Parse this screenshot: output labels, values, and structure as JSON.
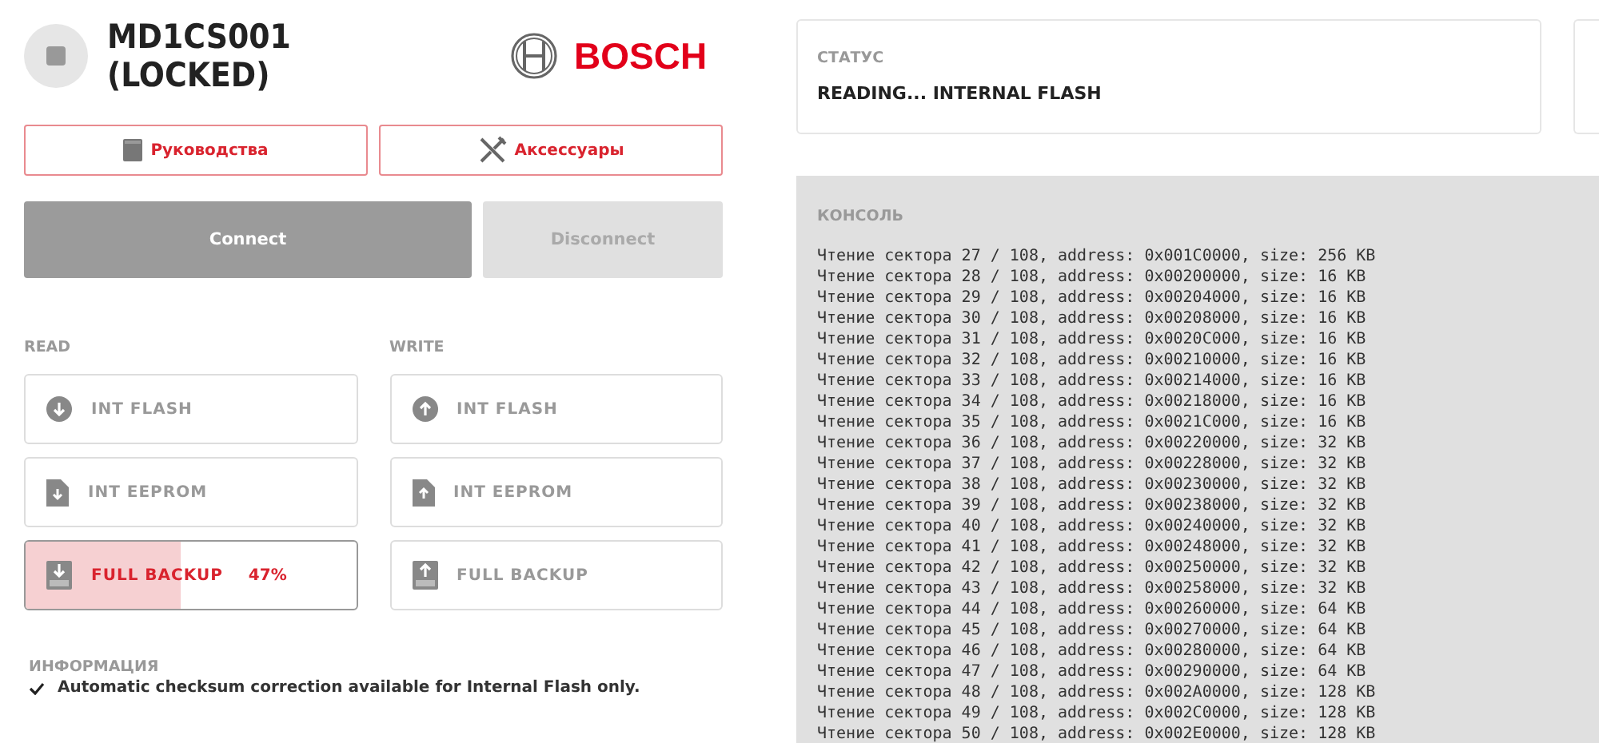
{
  "header": {
    "title": "MD1CS001 (LOCKED)",
    "brand": "BOSCH"
  },
  "links": [
    {
      "label": "Руководства",
      "kind": "book"
    },
    {
      "label": "Аксессуары",
      "kind": "tools"
    }
  ],
  "connection": [
    {
      "label": "Connect",
      "disabled": false
    },
    {
      "label": "Disconnect",
      "disabled": true
    }
  ],
  "read": {
    "title": "READ",
    "items": [
      {
        "label": "INT FLASH",
        "kind": "flash",
        "active": false
      },
      {
        "label": "INT EEPROM",
        "kind": "eeprom",
        "active": false
      },
      {
        "label": "FULL BACKUP",
        "kind": "backup",
        "active": true,
        "level": 0.47,
        "reading": "47%"
      }
    ]
  },
  "write": {
    "title": "WRITE",
    "items": [
      {
        "label": "INT FLASH",
        "kind": "flash",
        "active": false
      },
      {
        "label": "INT EEPROM",
        "kind": "eeprom",
        "active": false
      },
      {
        "label": "FULL BACKUP",
        "kind": "backup",
        "active": false
      }
    ]
  },
  "info": {
    "title": "ИНФОРМАЦИЯ",
    "items": [
      "Automatic checksum correction available for Internal Flash only."
    ]
  },
  "status": {
    "title": "СТАТУС",
    "value": "READING... INTERNAL FLASH"
  },
  "console": {
    "title": "КОНСОЛЬ",
    "lines": [
      "Чтение сектора 27 / 108, address: 0x001C0000, size: 256 KB",
      "Чтение сектора 28 / 108, address: 0x00200000, size: 16 KB",
      "Чтение сектора 29 / 108, address: 0x00204000, size: 16 KB",
      "Чтение сектора 30 / 108, address: 0x00208000, size: 16 KB",
      "Чтение сектора 31 / 108, address: 0x0020C000, size: 16 KB",
      "Чтение сектора 32 / 108, address: 0x00210000, size: 16 KB",
      "Чтение сектора 33 / 108, address: 0x00214000, size: 16 KB",
      "Чтение сектора 34 / 108, address: 0x00218000, size: 16 KB",
      "Чтение сектора 35 / 108, address: 0x0021C000, size: 16 KB",
      "Чтение сектора 36 / 108, address: 0x00220000, size: 32 KB",
      "Чтение сектора 37 / 108, address: 0x00228000, size: 32 KB",
      "Чтение сектора 38 / 108, address: 0x00230000, size: 32 KB",
      "Чтение сектора 39 / 108, address: 0x00238000, size: 32 KB",
      "Чтение сектора 40 / 108, address: 0x00240000, size: 32 KB",
      "Чтение сектора 41 / 108, address: 0x00248000, size: 32 KB",
      "Чтение сектора 42 / 108, address: 0x00250000, size: 32 KB",
      "Чтение сектора 43 / 108, address: 0x00258000, size: 32 KB",
      "Чтение сектора 44 / 108, address: 0x00260000, size: 64 KB",
      "Чтение сектора 45 / 108, address: 0x00270000, size: 64 KB",
      "Чтение сектора 46 / 108, address: 0x00280000, size: 64 KB",
      "Чтение сектора 47 / 108, address: 0x00290000, size: 64 KB",
      "Чтение сектора 48 / 108, address: 0x002A0000, size: 128 KB",
      "Чтение сектора 49 / 108, address: 0x002C0000, size: 128 KB",
      "Чтение сектора 50 / 108, address: 0x002E0000, size: 128 KB"
    ]
  }
}
